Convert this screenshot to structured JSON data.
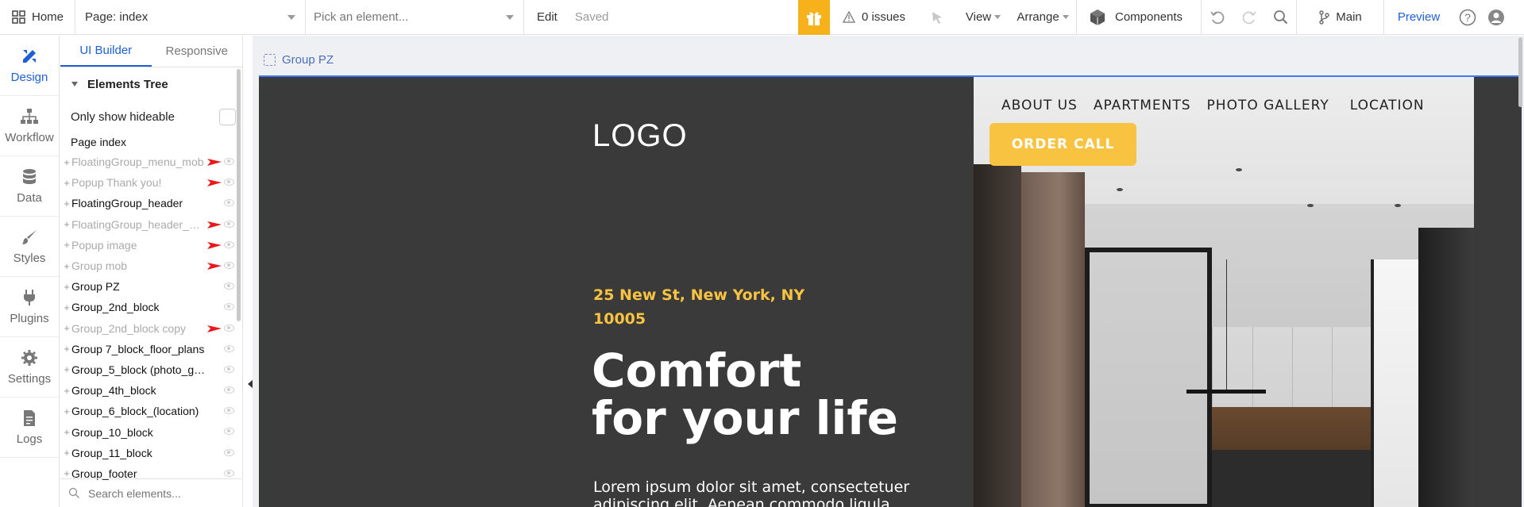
{
  "topbar": {
    "home_label": "Home",
    "page_label": "Page: index",
    "pick_placeholder": "Pick an element...",
    "edit_label": "Edit",
    "saved_label": "Saved",
    "issues_label": "0 issues",
    "view_label": "View",
    "arrange_label": "Arrange",
    "components_label": "Components",
    "branch_label": "Main",
    "preview_label": "Preview",
    "help_label": "?"
  },
  "leftnav": {
    "items": [
      {
        "label": "Design",
        "icon": "pencil-ruler-icon"
      },
      {
        "label": "Workflow",
        "icon": "workflow-icon"
      },
      {
        "label": "Data",
        "icon": "database-icon"
      },
      {
        "label": "Styles",
        "icon": "brush-icon"
      },
      {
        "label": "Plugins",
        "icon": "plug-icon"
      },
      {
        "label": "Settings",
        "icon": "gear-icon"
      },
      {
        "label": "Logs",
        "icon": "document-icon"
      }
    ]
  },
  "panel": {
    "tabs": [
      "UI Builder",
      "Responsive"
    ],
    "tree_title": "Elements Tree",
    "only_hideable_label": "Only show hideable",
    "page_index_label": "Page index",
    "items": [
      {
        "label": "FloatingGroup_menu_mob",
        "hidden": true,
        "arrow": true
      },
      {
        "label": "Popup Thank you!",
        "hidden": true,
        "arrow": true
      },
      {
        "label": "FloatingGroup_header",
        "hidden": false,
        "arrow": false
      },
      {
        "label": "FloatingGroup_header_mob",
        "hidden": true,
        "arrow": true
      },
      {
        "label": "Popup image",
        "hidden": true,
        "arrow": true
      },
      {
        "label": "Group mob",
        "hidden": true,
        "arrow": true
      },
      {
        "label": "Group PZ",
        "hidden": false,
        "arrow": false
      },
      {
        "label": "Group_2nd_block",
        "hidden": false,
        "arrow": false
      },
      {
        "label": "Group_2nd_block copy",
        "hidden": true,
        "arrow": true
      },
      {
        "label": "Group 7_block_floor_plans",
        "hidden": false,
        "arrow": false
      },
      {
        "label": "Group_5_block (photo_gall...",
        "hidden": false,
        "arrow": false
      },
      {
        "label": "Group_4th_block",
        "hidden": false,
        "arrow": false
      },
      {
        "label": "Group_6_block_(location)",
        "hidden": false,
        "arrow": false
      },
      {
        "label": "Group_10_block",
        "hidden": false,
        "arrow": false
      },
      {
        "label": "Group_11_block",
        "hidden": false,
        "arrow": false
      },
      {
        "label": "Group_footer",
        "hidden": false,
        "arrow": false
      }
    ],
    "search_placeholder": "Search elements..."
  },
  "canvas": {
    "breadcrumb": "Group PZ",
    "logo": "LOGO",
    "address": "25 New St, New York, NY 10005",
    "headline_line1": "Comfort",
    "headline_line2": "for your life",
    "body_text": "Lorem ipsum dolor sit amet, consectetuer adipiscing elit. Aenean commodo ligula",
    "nav_links": [
      "ABOUT US",
      "APARTMENTS",
      "PHOTO GALLERY",
      "LOCATION"
    ],
    "order_button": "ORDER CALL"
  },
  "colors": {
    "accent_blue": "#1f5fd6",
    "gift_orange": "#f7b21b",
    "artboard_bg": "#3a3a3a",
    "highlight_yellow": "#f7c341",
    "annotation_red": "#e8171a"
  }
}
